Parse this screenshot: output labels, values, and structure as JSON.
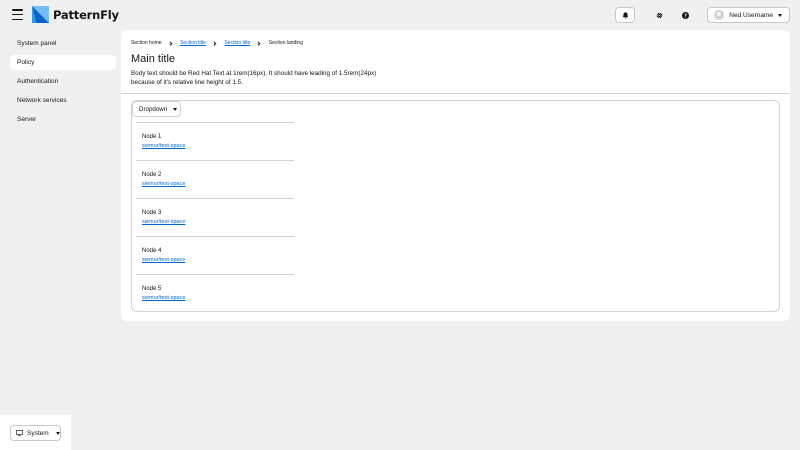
{
  "header": {
    "brand": "PatternFly",
    "user_name": "Ned Username"
  },
  "sidebar": {
    "items": [
      {
        "label": "System panel"
      },
      {
        "label": "Policy"
      },
      {
        "label": "Authentication"
      },
      {
        "label": "Network services"
      },
      {
        "label": "Server"
      }
    ],
    "footer_button": "System"
  },
  "main": {
    "breadcrumb": [
      "Section home",
      "Section title",
      "Section title",
      "Section landing"
    ],
    "title": "Main title",
    "description": "Body text should be Red Hat Text at 1rem(16px). It should have leading of 1.5rem(24px) because of it's relative line height of 1.5.",
    "dropdown_label": "Dropdown",
    "nodes": [
      {
        "name": "Node 1",
        "link": "siemur/test-space"
      },
      {
        "name": "Node 2",
        "link": "siemur/test-space"
      },
      {
        "name": "Node 3",
        "link": "siemur/test-space"
      },
      {
        "name": "Node 4",
        "link": "siemur/test-space"
      },
      {
        "name": "Node 5",
        "link": "siemur/test-space"
      }
    ]
  },
  "colors": {
    "brand_blue": "#2b9af3",
    "link": "#0066cc"
  }
}
